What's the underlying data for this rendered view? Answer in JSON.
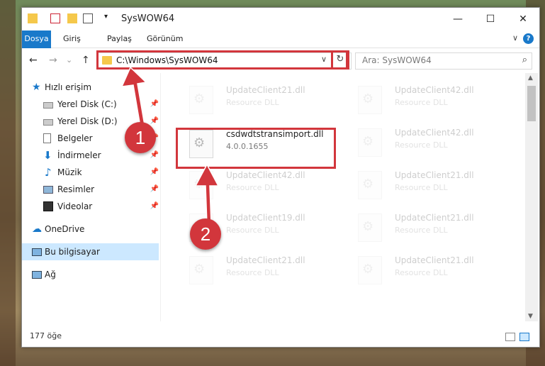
{
  "colors": {
    "accent": "#1979ca",
    "highlight": "#d2363c",
    "selected": "#cce8ff"
  },
  "window": {
    "title": "SysWOW64"
  },
  "window_controls": {
    "minimize": "—",
    "maximize": "☐",
    "close": "✕"
  },
  "ribbon": {
    "tabs": [
      "Dosya",
      "Giriş",
      "Paylaş",
      "Görünüm"
    ],
    "help": "?",
    "expand": "∨"
  },
  "nav": {
    "back": "←",
    "forward": "→",
    "recent": "⌄",
    "up": "↑",
    "address": "C:\\Windows\\SysWOW64",
    "address_drop": "∨",
    "refresh": "↻",
    "search_placeholder": "Ara: SysWOW64",
    "search_icon": "⌕"
  },
  "sidebar": {
    "items": [
      {
        "label": "Hızlı erişim",
        "icon": "star-icon",
        "pinned": false
      },
      {
        "label": "Yerel Disk (C:)",
        "icon": "drive-icon",
        "pinned": true
      },
      {
        "label": "Yerel Disk (D:)",
        "icon": "drive-icon",
        "pinned": true
      },
      {
        "label": "Belgeler",
        "icon": "documents-icon",
        "pinned": true
      },
      {
        "label": "İndirmeler",
        "icon": "download-icon",
        "pinned": true
      },
      {
        "label": "Müzik",
        "icon": "music-icon",
        "pinned": true
      },
      {
        "label": "Resimler",
        "icon": "pictures-icon",
        "pinned": true
      },
      {
        "label": "Videolar",
        "icon": "videos-icon",
        "pinned": true
      },
      {
        "label": "OneDrive",
        "icon": "cloud-icon",
        "pinned": false
      },
      {
        "label": "Bu bilgisayar",
        "icon": "computer-icon",
        "pinned": false
      },
      {
        "label": "Ağ",
        "icon": "network-icon",
        "pinned": false
      }
    ],
    "pin_glyph": "📌"
  },
  "files": {
    "highlighted": {
      "name": "csdwdtstransimport.dll",
      "sub": "4.0.0.1655"
    },
    "faded": [
      {
        "name": "UpdateClient21.dll",
        "sub": "Resource DLL"
      },
      {
        "name": "UpdateClient42.dll",
        "sub": "Resource DLL"
      },
      {
        "name": "UpdateClient42.dll",
        "sub": "Resource DLL"
      },
      {
        "name": "UpdateClient42.dll",
        "sub": "Resource DLL"
      },
      {
        "name": "UpdateClient21.dll",
        "sub": "Resource DLL"
      },
      {
        "name": "UpdateClient19.dll",
        "sub": "Resource DLL"
      },
      {
        "name": "UpdateClient21.dll",
        "sub": "Resource DLL"
      },
      {
        "name": "UpdateClient21.dll",
        "sub": "Resource DLL"
      },
      {
        "name": "UpdateClient21.dll",
        "sub": "Resource DLL"
      }
    ]
  },
  "scrollbar": {
    "up": "▲",
    "down": "▼"
  },
  "status": {
    "count": "177 öğe"
  },
  "annotations": {
    "step1": "1",
    "step2": "2"
  }
}
